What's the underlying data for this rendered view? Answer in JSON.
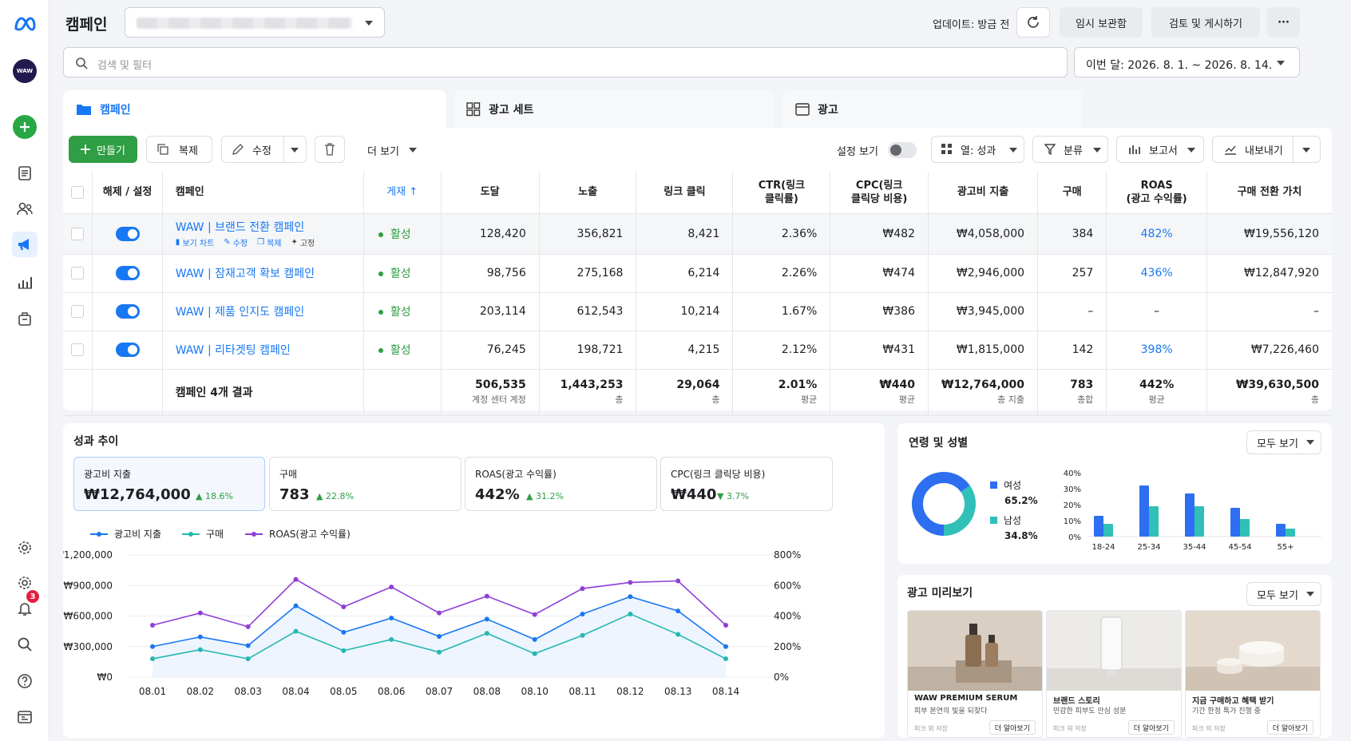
{
  "header": {
    "title": "캠페인",
    "update_label": "업데이트: 방금 전",
    "draft_button": "임시 보관함",
    "review_button": "검토 및 게시하기",
    "more_button": "···"
  },
  "sidebar": {
    "avatar_text": "WAW",
    "notification_count": "3"
  },
  "search": {
    "placeholder": "검색 및 필터"
  },
  "date_range": "이번 달: 2026. 8. 1. ~ 2026. 8. 14.",
  "tabs": [
    {
      "label": "캠페인",
      "active": true
    },
    {
      "label": "광고 세트",
      "active": false
    },
    {
      "label": "광고",
      "active": false
    }
  ],
  "toolbar": {
    "create": "만들기",
    "duplicate": "복제",
    "edit": "수정",
    "more": "더 보기",
    "settings_view": "설정 보기",
    "columns": "열: 성과",
    "breakdown": "분류",
    "reports": "보고서",
    "export": "내보내기"
  },
  "table": {
    "headers": {
      "toggle": "해제 / 설정",
      "campaign": "캠페인",
      "delivery": "게재 ↑",
      "reach": "도달",
      "impressions": "노출",
      "link_clicks": "링크 클릭",
      "ctr_1": "CTR(링크",
      "ctr_2": "클릭률)",
      "cpc_1": "CPC(링크",
      "cpc_2": "클릭당 비용)",
      "spend": "광고비 지출",
      "purchases": "구매",
      "roas_1": "ROAS",
      "roas_2": "(광고 수익률)",
      "conv_value": "구매 전환 가치"
    },
    "row_actions": {
      "chart": "보기 차트",
      "edit": "수정",
      "duplicate": "복제",
      "pin": "고정"
    },
    "rows": [
      {
        "name": "WAW | 브랜드 전환 캠페인",
        "status": "활성",
        "reach": "128,420",
        "impressions": "356,821",
        "clicks": "8,421",
        "ctr": "2.36%",
        "cpc": "₩482",
        "spend": "₩4,058,000",
        "purchases": "384",
        "roas": "482%",
        "value": "₩19,556,120"
      },
      {
        "name": "WAW | 잠재고객 확보 캠페인",
        "status": "활성",
        "reach": "98,756",
        "impressions": "275,168",
        "clicks": "6,214",
        "ctr": "2.26%",
        "cpc": "₩474",
        "spend": "₩2,946,000",
        "purchases": "257",
        "roas": "436%",
        "value": "₩12,847,920"
      },
      {
        "name": "WAW | 제품 인지도 캠페인",
        "status": "활성",
        "reach": "203,114",
        "impressions": "612,543",
        "clicks": "10,214",
        "ctr": "1.67%",
        "cpc": "₩386",
        "spend": "₩3,945,000",
        "purchases": "–",
        "roas": "–",
        "value": "–"
      },
      {
        "name": "WAW | 리타겟팅 캠페인",
        "status": "활성",
        "reach": "76,245",
        "impressions": "198,721",
        "clicks": "4,215",
        "ctr": "2.12%",
        "cpc": "₩431",
        "spend": "₩1,815,000",
        "purchases": "142",
        "roas": "398%",
        "value": "₩7,226,460"
      }
    ],
    "totals": {
      "label": "캠페인 4개 결과",
      "reach": "506,535",
      "reach_sub": "계정 센터 계정",
      "impressions": "1,443,253",
      "impressions_sub": "총",
      "clicks": "29,064",
      "clicks_sub": "총",
      "ctr": "2.01%",
      "ctr_sub": "평균",
      "cpc": "₩440",
      "cpc_sub": "평균",
      "spend": "₩12,764,000",
      "spend_sub": "총 지출",
      "purchases": "783",
      "purchases_sub": "총합",
      "roas": "442%",
      "roas_sub": "평균",
      "value": "₩39,630,500",
      "value_sub": "총"
    }
  },
  "performance": {
    "title": "성과 추이",
    "kpis": [
      {
        "label": "광고비 지출",
        "value": "₩12,764,000",
        "delta": "18.6%",
        "dir": "up"
      },
      {
        "label": "구매",
        "value": "783",
        "delta": "22.8%",
        "dir": "up"
      },
      {
        "label": "ROAS(광고 수익률)",
        "value": "442%",
        "delta": "31.2%",
        "dir": "up"
      },
      {
        "label": "CPC(링크 클릭당 비용)",
        "value": "₩440",
        "delta": "3.7%",
        "dir": "down"
      }
    ]
  },
  "demographics": {
    "title": "연령 및 성별",
    "dropdown": "모두 보기",
    "female_label": "여성",
    "female_value": "65.2%",
    "male_label": "남성",
    "male_value": "34.8%"
  },
  "ad_preview": {
    "title": "광고 미리보기",
    "dropdown": "모두 보기",
    "cards": [
      {
        "title": "WAW PREMIUM SERUM",
        "subtitle": "피부 본연의 빛을 되찾다",
        "source": "피크 회 저장",
        "cta": "더 알아보기"
      },
      {
        "title": "브랜드 스토리",
        "subtitle": "민감한 피부도 안심 성분",
        "source": "피크 워 저장",
        "cta": "더 알아보기"
      },
      {
        "title": "지금 구매하고 혜택 받기",
        "subtitle": "기간 한정 특가 진행 중",
        "source": "피크 의 저장",
        "cta": "더 알아보기"
      }
    ]
  },
  "colors": {
    "accent": "#1877f2",
    "teal": "#24b8b0",
    "purple": "#8e3fd6",
    "green": "#2f9e44"
  },
  "chart_data": [
    {
      "type": "line",
      "x": [
        "08.01",
        "08.02",
        "08.03",
        "08.04",
        "08.05",
        "08.06",
        "08.07",
        "08.08",
        "08.10",
        "08.11",
        "08.12",
        "08.13",
        "08.14"
      ],
      "y_left_ticks": [
        "₩1,200,000",
        "₩900,000",
        "₩600,000",
        "₩300,000",
        "₩0"
      ],
      "y_right_ticks": [
        "800%",
        "600%",
        "400%",
        "200%",
        "0%"
      ],
      "ylim_left": [
        0,
        1200000
      ],
      "ylim_right": [
        0,
        800
      ],
      "series": [
        {
          "name": "광고비 지출",
          "axis": "left",
          "color": "#1877f2",
          "values": [
            300000,
            395000,
            310000,
            700000,
            440000,
            580000,
            400000,
            570000,
            370000,
            620000,
            790000,
            650000,
            300000
          ]
        },
        {
          "name": "구매",
          "axis": "left",
          "color": "#24b8b0",
          "values": [
            180000,
            270000,
            180000,
            450000,
            260000,
            370000,
            245000,
            430000,
            230000,
            410000,
            620000,
            420000,
            180000
          ]
        },
        {
          "name": "ROAS(광고 수익률)",
          "axis": "right",
          "color": "#8e3fd6",
          "values": [
            340,
            420,
            330,
            640,
            460,
            590,
            420,
            530,
            410,
            580,
            620,
            630,
            340
          ]
        }
      ]
    },
    {
      "type": "pie",
      "categories": [
        "여성",
        "남성"
      ],
      "values": [
        65.2,
        34.8
      ],
      "colors": [
        "#2d6ff0",
        "#30c0b7"
      ]
    },
    {
      "type": "bar",
      "categories": [
        "18-24",
        "25-34",
        "35-44",
        "45-54",
        "55+"
      ],
      "y_ticks": [
        "40%",
        "30%",
        "20%",
        "10%",
        "0%"
      ],
      "ylim": [
        0,
        40
      ],
      "series": [
        {
          "color": "#2d6ff0",
          "values": [
            13,
            32,
            27,
            18,
            8
          ]
        },
        {
          "color": "#30c0b7",
          "values": [
            8,
            19,
            19,
            11,
            5
          ]
        }
      ]
    }
  ]
}
